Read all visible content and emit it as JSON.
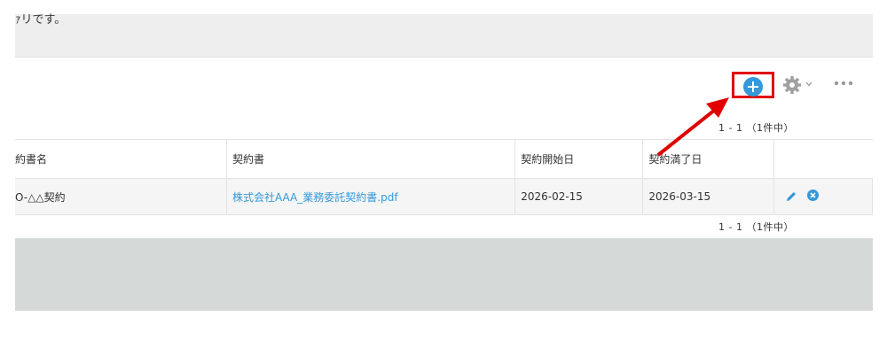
{
  "description": {
    "text": "ｧリです。"
  },
  "toolbar": {
    "add_icon": "plus-circle-icon",
    "settings_icon": "gear-icon",
    "more_icon": "more-horizontal-icon"
  },
  "pager": {
    "top": "1 - 1 （1件中）",
    "bottom": "1 - 1 （1件中）"
  },
  "table": {
    "headers": [
      "約書名",
      "契約書",
      "契約開始日",
      "契約満了日",
      ""
    ],
    "rows": [
      {
        "name": "O-△△契約",
        "file": "株式会社AAA_業務委託契約書.pdf",
        "start": "2026-02-15",
        "end": "2026-03-15"
      }
    ]
  },
  "colors": {
    "accent": "#3498db",
    "highlight": "#e00000",
    "footer_band": "#d5d9d8"
  }
}
